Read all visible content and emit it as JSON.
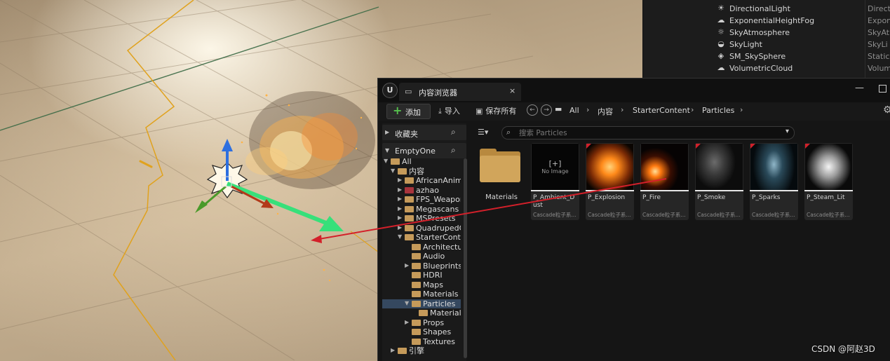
{
  "outliner": {
    "items": [
      {
        "icon": "directional-light-icon",
        "glyph": "☀",
        "name": "DirectionalLight",
        "type": "Direct"
      },
      {
        "icon": "fog-icon",
        "glyph": "☁",
        "name": "ExponentialHeightFog",
        "type": "Expon"
      },
      {
        "icon": "sky-atmosphere-icon",
        "glyph": "☼",
        "name": "SkyAtmosphere",
        "type": "SkyAt"
      },
      {
        "icon": "sky-light-icon",
        "glyph": "◒",
        "name": "SkyLight",
        "type": "SkyLi"
      },
      {
        "icon": "static-mesh-icon",
        "glyph": "◈",
        "name": "SM_SkySphere",
        "type": "Static"
      },
      {
        "icon": "volumetric-cloud-icon",
        "glyph": "☁",
        "name": "VolumetricCloud",
        "type": "Volum"
      }
    ]
  },
  "content_browser": {
    "logo": "U",
    "tab_title": "内容浏览器",
    "tab_close": "×",
    "window_min": "—",
    "toolbar": {
      "add_label": "添加",
      "add_glyph": "+",
      "import_label": "导入",
      "save_all_label": "保存所有",
      "settings_glyph": "⚙"
    },
    "breadcrumbs": [
      "All",
      "内容",
      "StarterContent",
      "Particles"
    ],
    "sources": {
      "favorites_label": "收藏夹",
      "project_label": "EmptyOne",
      "tree": [
        {
          "label": "All",
          "indent": 0,
          "open": true,
          "color": "folder",
          "selected": false
        },
        {
          "label": "内容",
          "indent": 1,
          "open": true,
          "color": "folder",
          "selected": false
        },
        {
          "label": "AfricanAnim",
          "indent": 2,
          "open": false,
          "color": "folder",
          "selected": false
        },
        {
          "label": "azhao",
          "indent": 2,
          "open": false,
          "color": "red",
          "selected": false
        },
        {
          "label": "FPS_Weapon",
          "indent": 2,
          "open": false,
          "color": "folder",
          "selected": false
        },
        {
          "label": "Megascans",
          "indent": 2,
          "open": false,
          "color": "folder",
          "selected": false
        },
        {
          "label": "MSPresets",
          "indent": 2,
          "open": false,
          "color": "folder",
          "selected": false
        },
        {
          "label": "QuadrupedC",
          "indent": 2,
          "open": false,
          "color": "folder",
          "selected": false
        },
        {
          "label": "StarterConte",
          "indent": 2,
          "open": true,
          "color": "folder",
          "selected": false
        },
        {
          "label": "Architectur",
          "indent": 3,
          "open": null,
          "color": "folder",
          "selected": false
        },
        {
          "label": "Audio",
          "indent": 3,
          "open": null,
          "color": "folder",
          "selected": false
        },
        {
          "label": "Blueprints",
          "indent": 3,
          "open": false,
          "color": "folder",
          "selected": false
        },
        {
          "label": "HDRI",
          "indent": 3,
          "open": null,
          "color": "folder",
          "selected": false
        },
        {
          "label": "Maps",
          "indent": 3,
          "open": null,
          "color": "folder",
          "selected": false
        },
        {
          "label": "Materials",
          "indent": 3,
          "open": null,
          "color": "folder",
          "selected": false
        },
        {
          "label": "Particles",
          "indent": 3,
          "open": true,
          "color": "folder",
          "selected": true
        },
        {
          "label": "Materials",
          "indent": 4,
          "open": null,
          "color": "folder",
          "selected": false
        },
        {
          "label": "Props",
          "indent": 3,
          "open": false,
          "color": "folder",
          "selected": false
        },
        {
          "label": "Shapes",
          "indent": 3,
          "open": null,
          "color": "folder",
          "selected": false
        },
        {
          "label": "Textures",
          "indent": 3,
          "open": null,
          "color": "folder",
          "selected": false
        },
        {
          "label": "引擎",
          "indent": 1,
          "open": false,
          "color": "folder",
          "selected": false
        }
      ]
    },
    "search": {
      "placeholder": "搜索 Particles"
    },
    "folder": {
      "label": "Materials"
    },
    "assets": [
      {
        "name": "P_Ambient_Dust",
        "type": "Cascade粒子系...",
        "thumb": "noimage",
        "no_image_label": "No Image",
        "corner": false
      },
      {
        "name": "P_Explosion",
        "type": "Cascade粒子系...",
        "thumb": "explosion",
        "corner": true
      },
      {
        "name": "P_Fire",
        "type": "Cascade粒子系...",
        "thumb": "fire",
        "corner": false
      },
      {
        "name": "P_Smoke",
        "type": "Cascade粒子系...",
        "thumb": "smoke",
        "corner": true
      },
      {
        "name": "P_Sparks",
        "type": "Cascade粒子系...",
        "thumb": "sparks",
        "corner": true
      },
      {
        "name": "P_Steam_Lit",
        "type": "Cascade粒子系...",
        "thumb": "steam",
        "corner": true
      }
    ]
  },
  "watermark": "CSDN @阿赵3D",
  "colors": {
    "accent_add": "#57c14e",
    "selection": "#35485f",
    "folder": "#c59a5a",
    "annotation_arrow": "#d3202a"
  }
}
